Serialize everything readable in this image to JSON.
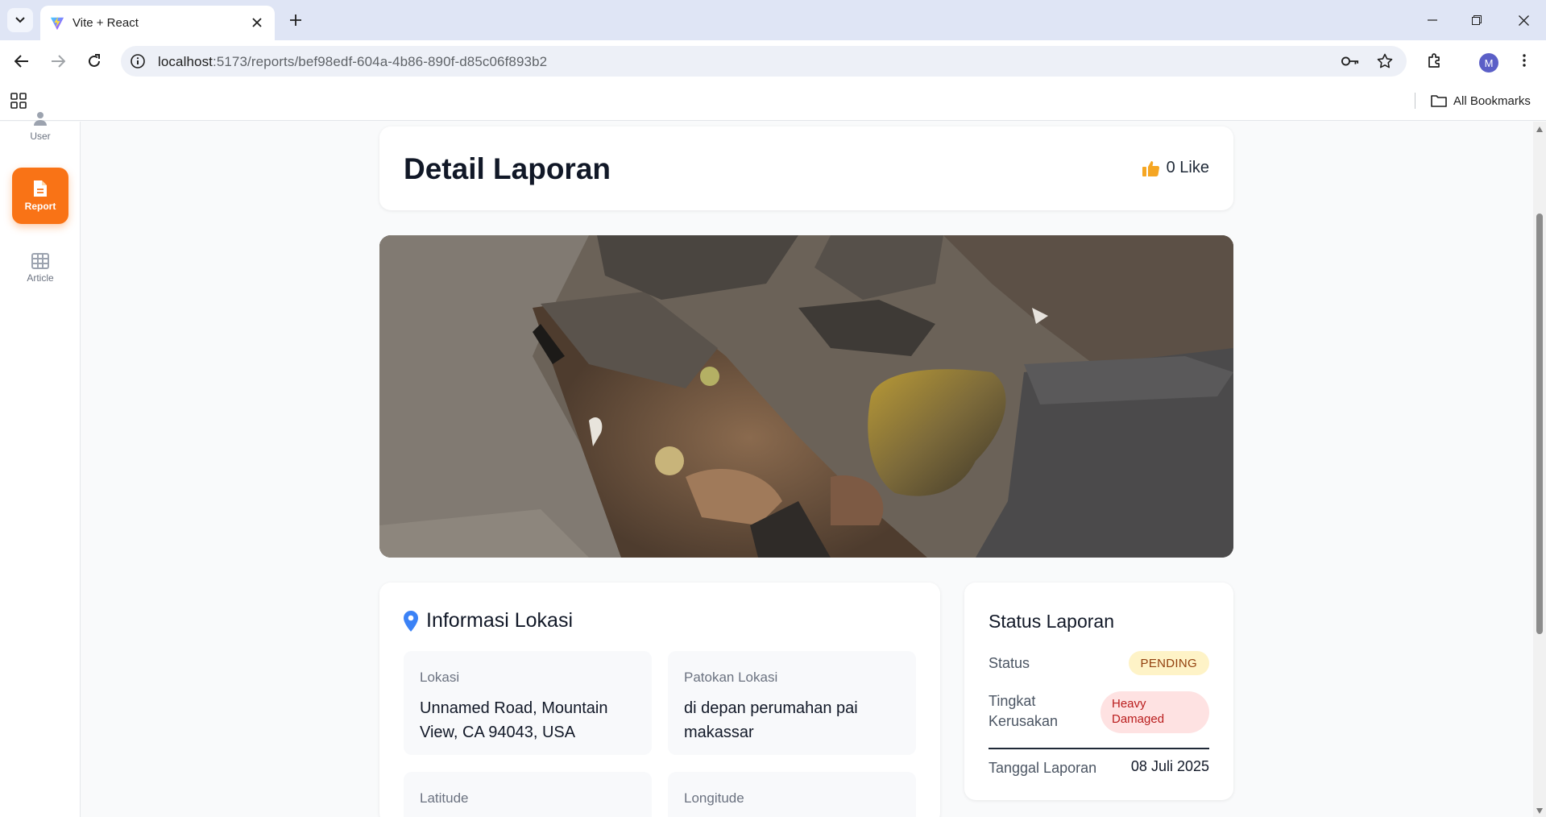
{
  "browser": {
    "tab_title": "Vite + React",
    "url_host": "localhost",
    "url_path": ":5173/reports/bef98edf-604a-4b86-890f-d85c06f893b2",
    "bookmarks_label": "All Bookmarks",
    "profile_initial": "M"
  },
  "sidebar": {
    "items": [
      {
        "label": "User",
        "icon": "user-icon"
      },
      {
        "label": "Report",
        "icon": "document-icon",
        "active": true
      },
      {
        "label": "Article",
        "icon": "grid-icon"
      }
    ]
  },
  "header": {
    "title": "Detail Laporan",
    "like_label": "0 Like"
  },
  "location": {
    "title": "Informasi Lokasi",
    "fields": [
      {
        "label": "Lokasi",
        "value": "Unnamed Road, Mountain View, CA 94043, USA"
      },
      {
        "label": "Patokan Lokasi",
        "value": "di depan perumahan pai makassar"
      },
      {
        "label": "Latitude",
        "value": ""
      },
      {
        "label": "Longitude",
        "value": ""
      }
    ]
  },
  "status": {
    "title": "Status Laporan",
    "status_label": "Status",
    "status_value": "PENDING",
    "damage_label": "Tingkat Kerusakan",
    "damage_value": "Heavy Damaged",
    "date_label": "Tanggal Laporan",
    "date_value": "08 Juli 2025"
  },
  "colors": {
    "accent": "#f97316",
    "like_icon": "#f5a623",
    "location_pin": "#3b82f6",
    "pending_bg": "#fef3c7",
    "damage_bg": "#fee2e2"
  }
}
